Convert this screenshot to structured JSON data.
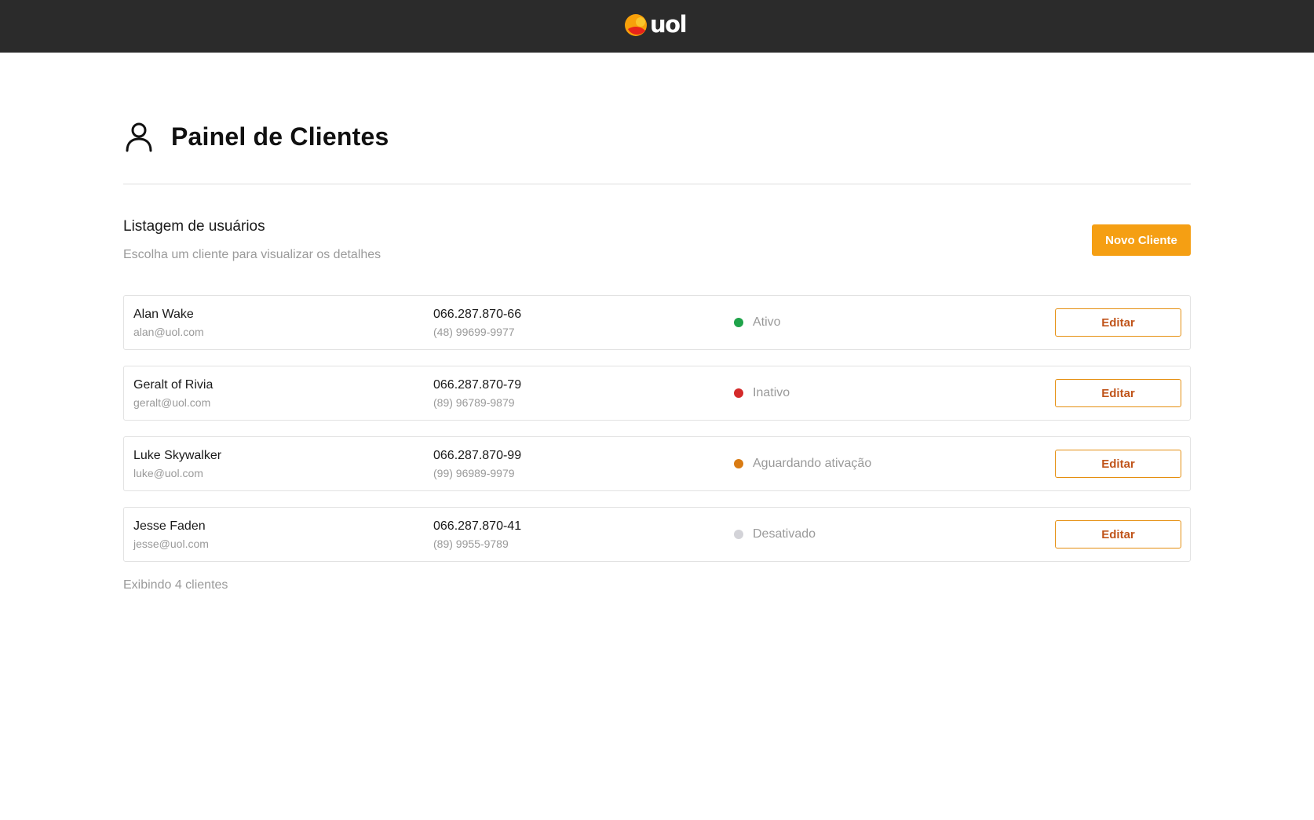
{
  "brand": {
    "logo_text": "uol"
  },
  "header": {
    "title": "Painel de Clientes"
  },
  "list": {
    "heading": "Listagem de usuários",
    "subheading": "Escolha um cliente para visualizar os detalhes",
    "new_button_label": "Novo Cliente"
  },
  "clients": [
    {
      "name": "Alan Wake",
      "email": "alan@uol.com",
      "cpf": "066.287.870-66",
      "phone": "(48) 99699-9977",
      "status": "Ativo",
      "status_color": "#1fa34a",
      "edit_label": "Editar"
    },
    {
      "name": "Geralt of Rivia",
      "email": "geralt@uol.com",
      "cpf": "066.287.870-79",
      "phone": "(89) 96789-9879",
      "status": "Inativo",
      "status_color": "#d42a2a",
      "edit_label": "Editar"
    },
    {
      "name": "Luke Skywalker",
      "email": "luke@uol.com",
      "cpf": "066.287.870-99",
      "phone": "(99) 96989-9979",
      "status": "Aguardando ativação",
      "status_color": "#d97b13",
      "edit_label": "Editar"
    },
    {
      "name": "Jesse Faden",
      "email": "jesse@uol.com",
      "cpf": "066.287.870-41",
      "phone": "(89) 9955-9789",
      "status": "Desativado",
      "status_color": "#d3d3d8",
      "edit_label": "Editar"
    }
  ],
  "footer": {
    "count_text": "Exibindo 4 clientes"
  },
  "colors": {
    "topbar": "#2b2b2b",
    "accent": "#f59f13",
    "edit_text": "#c0541a"
  }
}
